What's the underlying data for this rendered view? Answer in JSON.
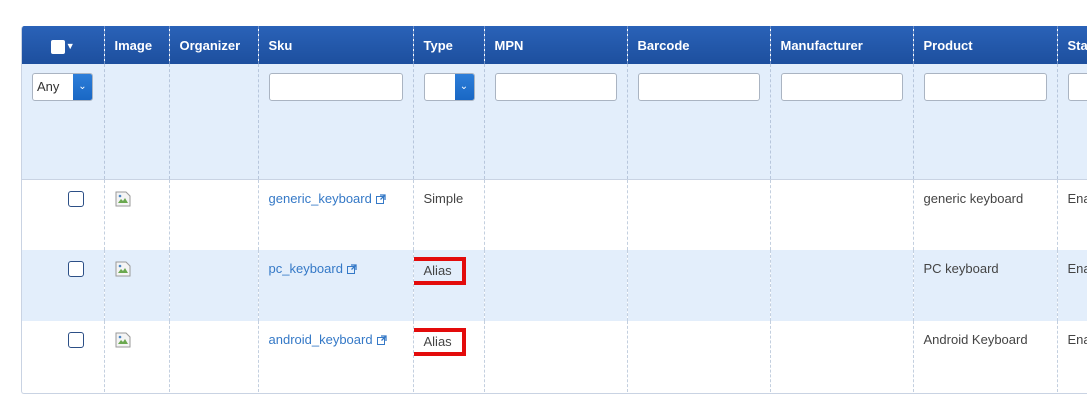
{
  "columns": {
    "image": "Image",
    "organizer": "Organizer",
    "sku": "Sku",
    "type": "Type",
    "mpn": "MPN",
    "barcode": "Barcode",
    "manufacturer": "Manufacturer",
    "product": "Product",
    "status": "Sta"
  },
  "filters": {
    "checkbox_select_value": "Any",
    "type_select_value": ""
  },
  "rows": [
    {
      "sku": "generic_keyboard",
      "type": "Simple",
      "product": "generic keyboard",
      "status": "Ena",
      "type_highlighted": false
    },
    {
      "sku": "pc_keyboard",
      "type": "Alias",
      "product": "PC keyboard",
      "status": "Ena",
      "type_highlighted": true
    },
    {
      "sku": "android_keyboard",
      "type": "Alias",
      "product": "Android Keyboard",
      "status": "Ena",
      "type_highlighted": true
    }
  ],
  "colors": {
    "header_bg": "#1d4f9e",
    "filter_bg": "#e3eefb",
    "link": "#3579c7",
    "highlight": "#e30b0b"
  },
  "icons": {
    "broken_image": "broken-image-icon",
    "external_link": "external-link-icon"
  }
}
